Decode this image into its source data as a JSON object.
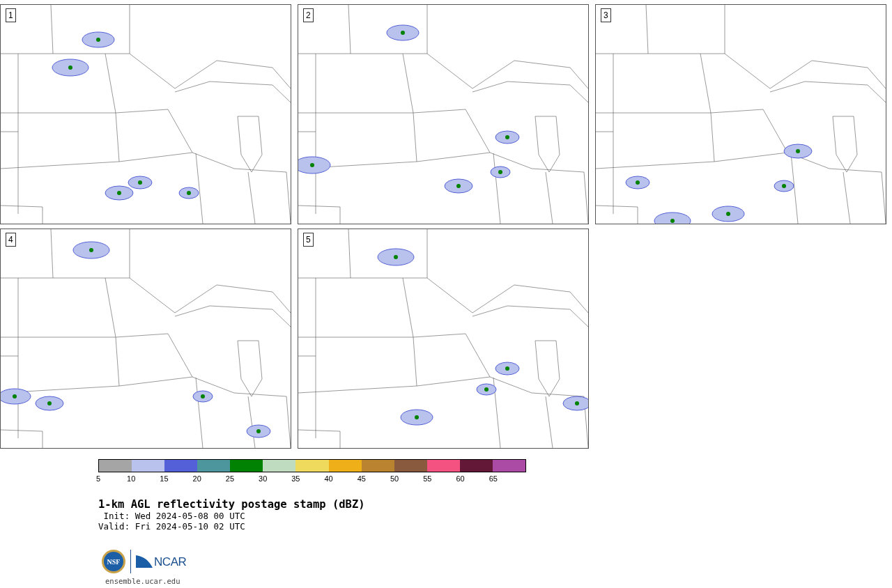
{
  "panels": [
    {
      "label": "1"
    },
    {
      "label": "2"
    },
    {
      "label": "3"
    },
    {
      "label": "4"
    },
    {
      "label": "5"
    }
  ],
  "colorbar": {
    "segments": [
      {
        "color": "#a5a5a5"
      },
      {
        "color": "#b8c2ec"
      },
      {
        "color": "#5460d7"
      },
      {
        "color": "#4e969e"
      },
      {
        "color": "#028202"
      },
      {
        "color": "#bfdcc0"
      },
      {
        "color": "#f0da5d"
      },
      {
        "color": "#efaf18"
      },
      {
        "color": "#b98330"
      },
      {
        "color": "#8a5a3e"
      },
      {
        "color": "#f45281"
      },
      {
        "color": "#641837"
      },
      {
        "color": "#ac4ba6"
      }
    ],
    "tick_labels": [
      "5",
      "10",
      "15",
      "20",
      "25",
      "30",
      "35",
      "40",
      "45",
      "50",
      "55",
      "60",
      "65"
    ]
  },
  "title": "1-km AGL reflectivity postage stamp (dBZ)",
  "init": " Init: Wed 2024-05-08 00 UTC",
  "valid": "Valid: Fri 2024-05-10 02 UTC",
  "logos": {
    "nsf": "NSF",
    "ncar": "NCAR"
  },
  "footer": "ensemble.ucar.edu"
}
